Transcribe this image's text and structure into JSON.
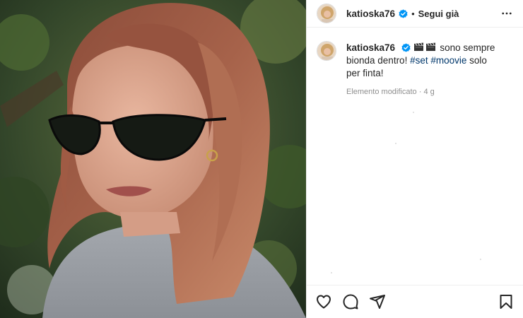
{
  "post": {
    "username": "katioska76",
    "follow_status": "Segui già",
    "separator": "•",
    "caption_text_1": " sono sempre bionda dentro! ",
    "hashtags": [
      "#set",
      "#moovie"
    ],
    "caption_text_2": " solo per finta!",
    "edited_label": "Elemento modificato",
    "meta_separator": " · ",
    "time_ago": "4 g"
  },
  "icons": {
    "verified": "verified-badge-icon",
    "more": "more-options-icon",
    "clapper": "clapper-board-emoji",
    "like": "heart-icon",
    "comment": "comment-icon",
    "share": "share-icon",
    "save": "bookmark-icon"
  },
  "colors": {
    "verified_blue": "#0095f6",
    "hashtag": "#00376b",
    "meta_gray": "#8e8e8e",
    "text": "#262626"
  }
}
